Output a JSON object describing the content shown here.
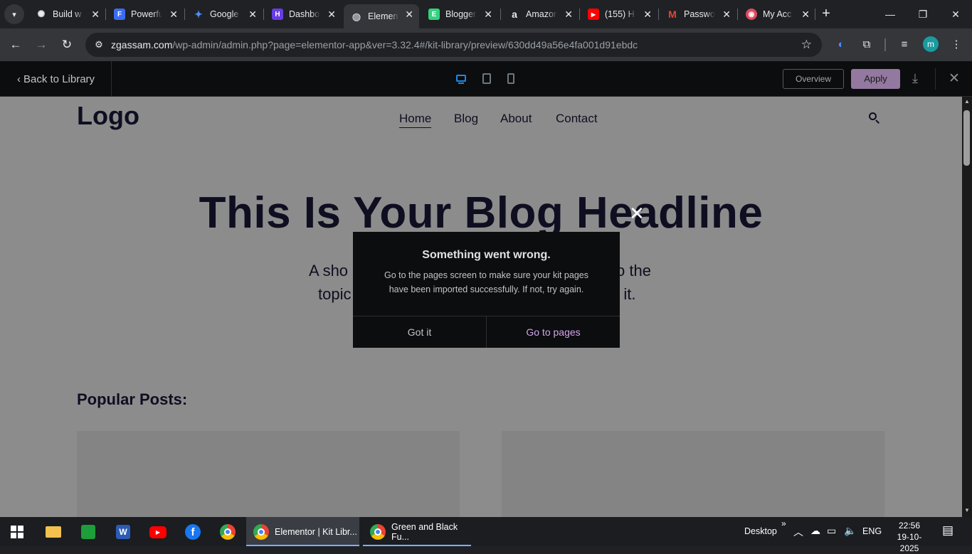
{
  "browser": {
    "tabs": [
      {
        "title": "Build w",
        "icon": "openai-icon",
        "color": "#202124"
      },
      {
        "title": "Powerfu",
        "icon": "forms-icon",
        "color": "#3b6cf6"
      },
      {
        "title": "Google",
        "icon": "gemini-icon",
        "color": "#202124"
      },
      {
        "title": "Dashbo",
        "icon": "hostinger-icon",
        "color": "#673de6"
      },
      {
        "title": "Elemen",
        "icon": "globe-icon",
        "color": "#35363a"
      },
      {
        "title": "Blogger",
        "icon": "blogger-icon",
        "color": "#35d07f"
      },
      {
        "title": "Amazon",
        "icon": "amazon-icon",
        "color": "#202124"
      },
      {
        "title": "(155) H",
        "icon": "youtube-icon",
        "color": "#ff0000"
      },
      {
        "title": "Passwo",
        "icon": "gmail-icon",
        "color": "#202124"
      },
      {
        "title": "My Acc",
        "icon": "account-icon",
        "color": "#e04a5f"
      }
    ],
    "url_host": "zgassam.com",
    "url_path": "/wp-admin/admin.php?page=elementor-app&ver=3.32.4#/kit-library/preview/630dd49a56e4fa001d91ebdc",
    "profile_initial": "m"
  },
  "elementor": {
    "back_label": "Back to Library",
    "overview_label": "Overview",
    "apply_label": "Apply",
    "accent": "#93789f"
  },
  "preview": {
    "logo": "Logo",
    "nav": [
      "Home",
      "Blog",
      "About",
      "Contact"
    ],
    "headline": "This Is Your Blog Headline",
    "subtitle_left_1": "A sho",
    "subtitle_right_1": "o the",
    "subtitle_left_2": "topic",
    "subtitle_right_2": "n it.",
    "popular_title": "Popular Posts:"
  },
  "dialog": {
    "title": "Something went wrong.",
    "message": "Go to the pages screen to make sure your kit pages have been imported successfully. If not, try again.",
    "got_it": "Got it",
    "go_to_pages": "Go to pages"
  },
  "taskbar": {
    "apps": [
      {
        "label": "Elementor | Kit Libr..."
      },
      {
        "label": "Green and Black Fu..."
      }
    ],
    "desktop_label": "Desktop",
    "language": "ENG",
    "time": "22:56",
    "date": "19-10-2025"
  }
}
